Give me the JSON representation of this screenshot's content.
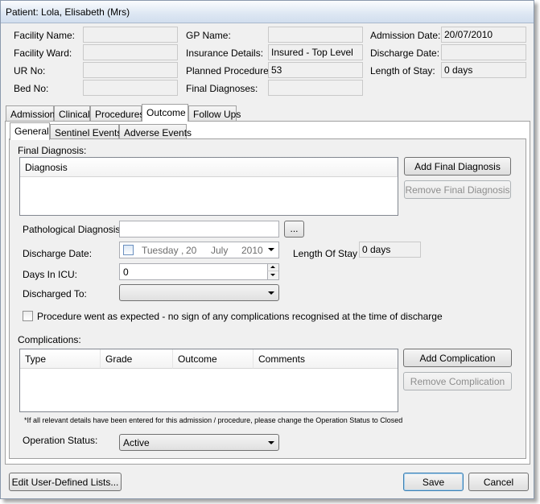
{
  "window": {
    "title": "Patient: Lola, Elisabeth (Mrs)"
  },
  "header": {
    "facility_name_label": "Facility Name:",
    "facility_name": "",
    "facility_ward_label": "Facility Ward:",
    "facility_ward": "",
    "ur_no_label": "UR No:",
    "ur_no": "",
    "bed_no_label": "Bed No:",
    "bed_no": "",
    "gp_name_label": "GP Name:",
    "gp_name": "",
    "insurance_label": "Insurance Details:",
    "insurance": "Insured - Top Level",
    "planned_label": "Planned Procedures:",
    "planned": "53",
    "final_diag_label": "Final Diagnoses:",
    "final_diag": "",
    "admission_date_label": "Admission Date:",
    "admission_date": "20/07/2010",
    "discharge_date_label": "Discharge Date:",
    "discharge_date": "",
    "length_of_stay_label": "Length of Stay:",
    "length_of_stay": "0 days"
  },
  "tabs": [
    "Admission",
    "Clinical",
    "Procedures",
    "Outcome",
    "Follow Ups"
  ],
  "subtabs": [
    "General",
    "Sentinel Events",
    "Adverse Events"
  ],
  "general": {
    "final_diagnosis_label": "Final Diagnosis:",
    "diagnosis_col": "Diagnosis",
    "add_final_diagnosis": "Add Final Diagnosis",
    "remove_final_diagnosis": "Remove Final Diagnosis",
    "pathological_label": "Pathological Diagnosis:",
    "pathological_value": "",
    "browse_label": "...",
    "discharge_date_label": "Discharge Date:",
    "discharge_day": "Tuesday",
    "discharge_sep": ",",
    "discharge_date_num": "20",
    "discharge_month": "July",
    "discharge_year": "2010",
    "length_of_stay_label": "Length Of Stay",
    "length_of_stay": "0 days",
    "days_icu_label": "Days In ICU:",
    "days_icu": "0",
    "discharged_to_label": "Discharged To:",
    "discharged_to": "",
    "procedure_checkbox_label": "Procedure went as expected - no sign of any complications recognised at the time of discharge",
    "complications_label": "Complications:",
    "comp_cols": [
      "Type",
      "Grade",
      "Outcome",
      "Comments"
    ],
    "add_complication": "Add Complication",
    "remove_complication": "Remove Complication",
    "note": "*If all relevant details have been entered for this admission / procedure, please change the Operation Status to Closed",
    "operation_status_label": "Operation Status:",
    "operation_status": "Active"
  },
  "footer": {
    "edit_lists": "Edit User-Defined Lists...",
    "save": "Save",
    "cancel": "Cancel"
  }
}
